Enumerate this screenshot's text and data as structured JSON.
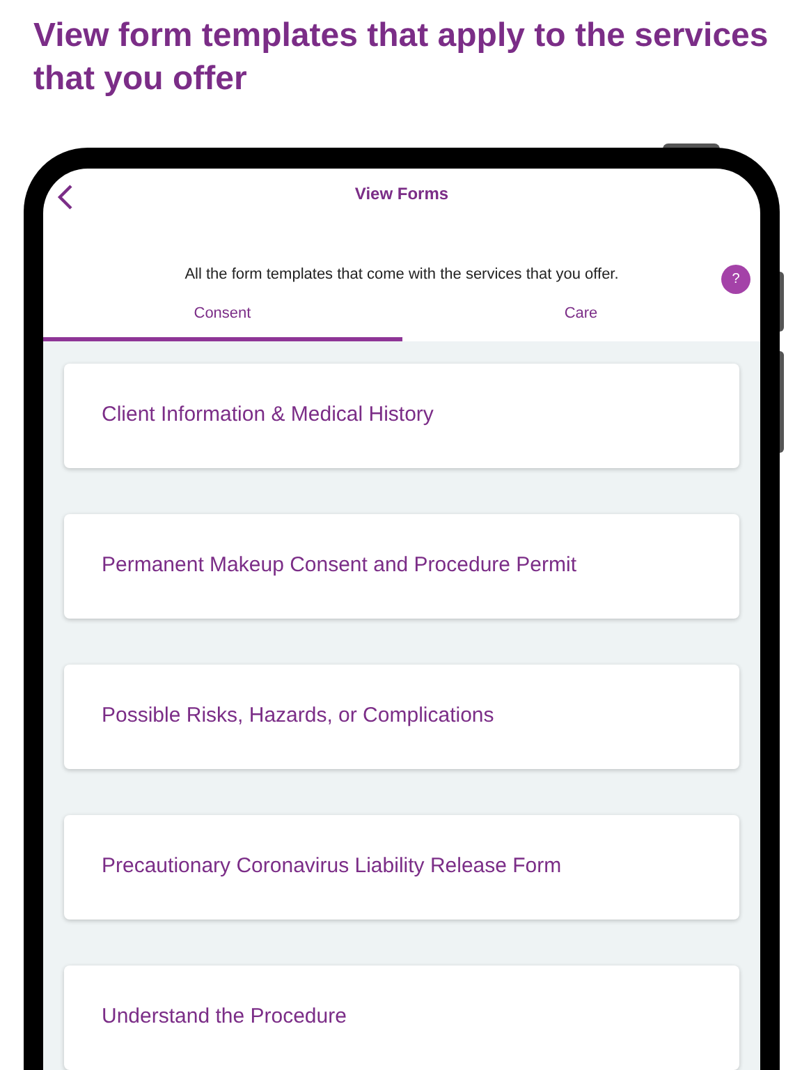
{
  "headline": "View form templates that apply to the services that you offer",
  "nav": {
    "title": "View Forms"
  },
  "description": "All the form templates that come with the services that you offer.",
  "help": "?",
  "tabs": [
    {
      "label": "Consent",
      "selected": true
    },
    {
      "label": "Care",
      "selected": false
    }
  ],
  "forms": [
    "Client Information & Medical History",
    "Permanent Makeup Consent and Procedure Permit",
    "Possible Risks, Hazards, or Complications",
    "Precautionary Coronavirus Liability Release Form",
    "Understand the Procedure"
  ]
}
